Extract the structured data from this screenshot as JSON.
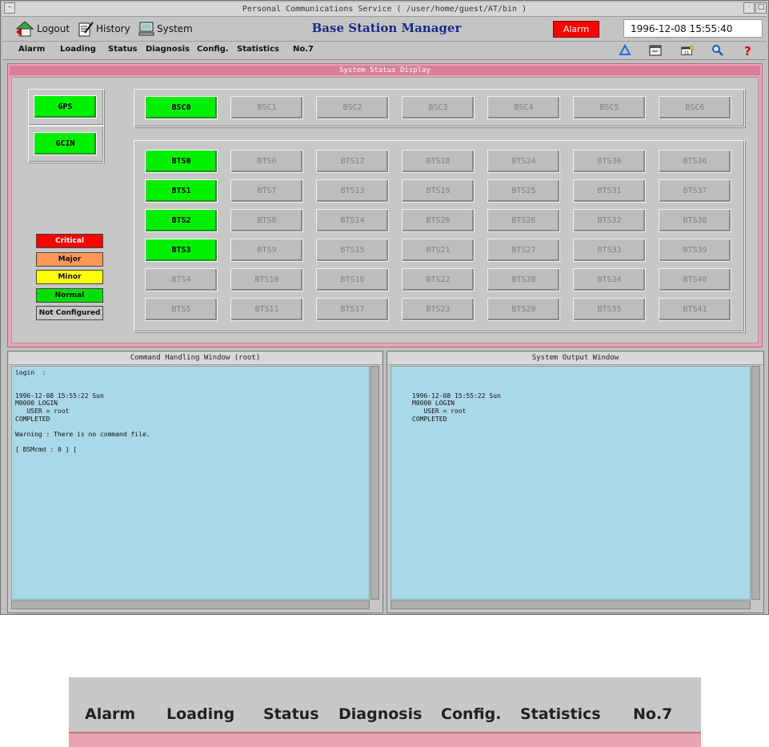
{
  "window": {
    "title": "Personal Communications Service ( /user/home/guest/AT/bin )"
  },
  "toolbar": {
    "logout_label": "Logout",
    "history_label": "History",
    "system_label": "System",
    "app_title": "Base Station Manager",
    "alarm_label": "Alarm",
    "datetime": "1996-12-08 15:55:40"
  },
  "menu": {
    "items": [
      "Alarm",
      "Loading",
      "Status",
      "Diagnosis",
      "Config.",
      "Statistics",
      "No.7"
    ],
    "icons": [
      "recycle-icon",
      "window-icon",
      "calendar-icon",
      "search-icon",
      "help-icon"
    ]
  },
  "status_display": {
    "title": "System Status Display",
    "gps_label": "GPS",
    "gcin_label": "GCIN",
    "bsc": [
      {
        "label": "BSC0",
        "state": "normal"
      },
      {
        "label": "BSC1",
        "state": "not-configured"
      },
      {
        "label": "BSC2",
        "state": "not-configured"
      },
      {
        "label": "BSC3",
        "state": "not-configured"
      },
      {
        "label": "BSC4",
        "state": "not-configured"
      },
      {
        "label": "BSC5",
        "state": "not-configured"
      },
      {
        "label": "BSC6",
        "state": "not-configured"
      }
    ],
    "bts_columns": [
      [
        "BTS0",
        "BTS1",
        "BTS2",
        "BTS3",
        "BTS4",
        "BTS5"
      ],
      [
        "BTS6",
        "BTS7",
        "BTS8",
        "BTS9",
        "BTS10",
        "BTS11"
      ],
      [
        "BTS12",
        "BTS13",
        "BTS14",
        "BTS15",
        "BTS16",
        "BTS17"
      ],
      [
        "BTS18",
        "BTS19",
        "BTS20",
        "BTS21",
        "BTS22",
        "BTS23"
      ],
      [
        "BTS24",
        "BTS25",
        "BTS26",
        "BTS27",
        "BTS28",
        "BTS29"
      ],
      [
        "BTS30",
        "BTS31",
        "BTS32",
        "BTS33",
        "BTS34",
        "BTS35"
      ],
      [
        "BTS36",
        "BTS37",
        "BTS38",
        "BTS39",
        "BTS40",
        "BTS41"
      ]
    ],
    "bts_normal": [
      "BTS0",
      "BTS1",
      "BTS2",
      "BTS3"
    ],
    "legend": [
      {
        "label": "Critical",
        "color": "#ff0000",
        "text_color": "#ffffff"
      },
      {
        "label": "Major",
        "color": "#ff9955",
        "text_color": "#111111"
      },
      {
        "label": "Minor",
        "color": "#ffff00",
        "text_color": "#111111"
      },
      {
        "label": "Normal",
        "color": "#00e000",
        "text_color": "#111111"
      },
      {
        "label": "Not Configured",
        "color": "#c8c8c8",
        "text_color": "#111111"
      }
    ]
  },
  "command_window": {
    "title": "Command Handling Window (root)",
    "lines": [
      "login  :",
      "",
      "",
      "1996-12-08 15:55:22 Sun",
      "M0000 LOGIN",
      "   USER = root",
      "COMPLETED",
      "",
      "Warning : There is no command file.",
      "",
      "[ BSMcmd : 0 ] [",
      "",
      ""
    ]
  },
  "output_window": {
    "title": "System Output Window",
    "lines": [
      "",
      "",
      "",
      "1996-12-08 15:55:22 Sun",
      "M0000 LOGIN",
      "   USER = root",
      "COMPLETED"
    ]
  },
  "zoom_inset": {
    "items": [
      "Alarm",
      "Loading",
      "Status",
      "Diagnosis",
      "Config.",
      "Statistics",
      "No.7"
    ]
  },
  "colors": {
    "normal": "#00f000",
    "alarm": "#ff0000",
    "panel_pink": "#e8a4b4",
    "terminal_bg": "#aad8e6",
    "title_blue": "#1a2a8a"
  }
}
